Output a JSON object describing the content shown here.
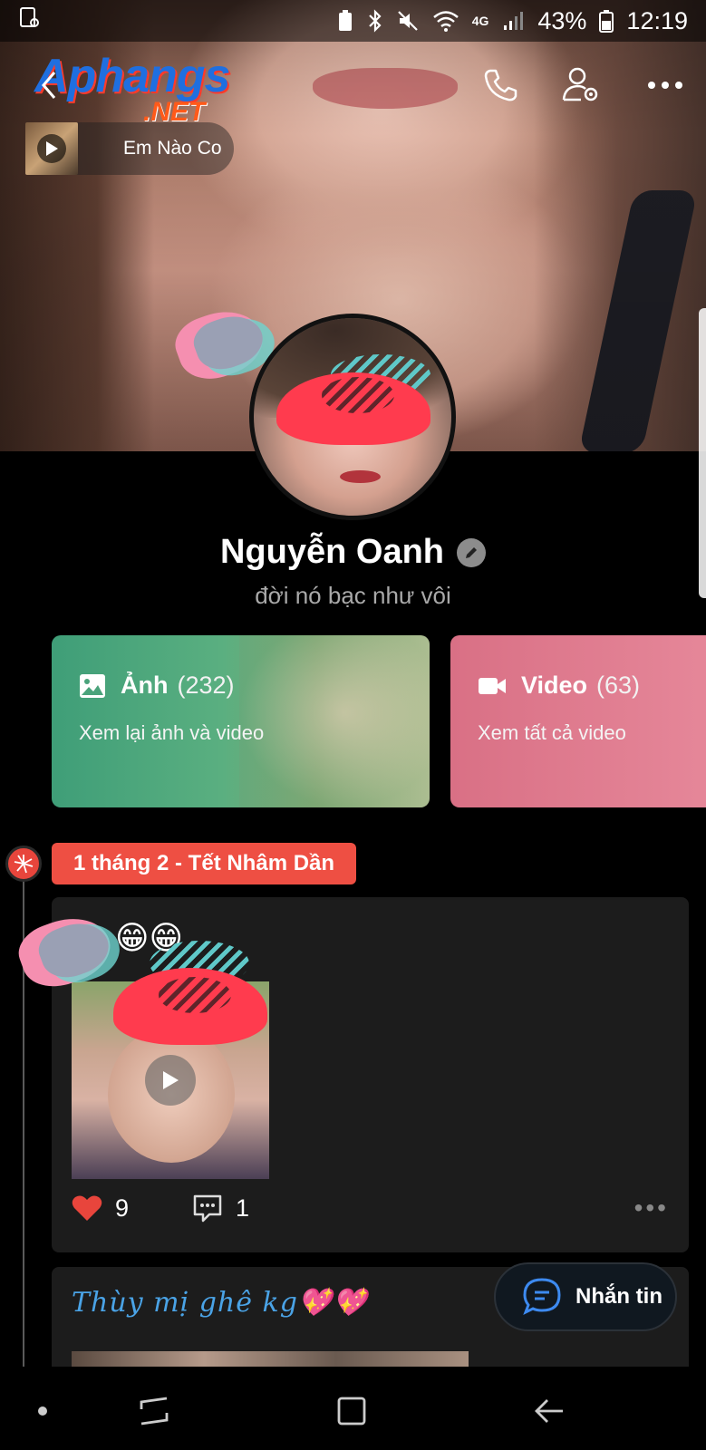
{
  "status_bar": {
    "battery": "43%",
    "time": "12:19",
    "network": "4G"
  },
  "logo": {
    "line1": "Aphangs",
    "line2": ".NET"
  },
  "music": {
    "title": "Em Nào Co"
  },
  "profile": {
    "name": "Nguyễn Oanh",
    "bio": "đời nó bạc như vôi"
  },
  "cards": {
    "photo": {
      "label": "Ảnh",
      "count": "(232)",
      "subtitle": "Xem lại ảnh và video"
    },
    "video": {
      "label": "Video",
      "count": "(63)",
      "subtitle": "Xem tất cả video"
    }
  },
  "timeline": {
    "date_label": "1 tháng 2 - Tết Nhâm Dần"
  },
  "post1": {
    "emoji": "😁😁",
    "likes": "9",
    "comments": "1",
    "more": "•••"
  },
  "post2": {
    "caption": "Thùy mị ghê kg💖💖"
  },
  "fab": {
    "label": "Nhắn tin"
  },
  "colors": {
    "accent_red": "#ee4f43",
    "photo_card": "#3f9e78",
    "video_card": "#d97085",
    "caption_blue": "#4aa3e6"
  }
}
